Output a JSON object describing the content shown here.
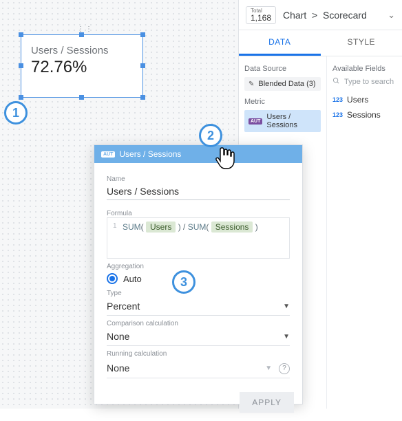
{
  "scorecard": {
    "label": "Users / Sessions",
    "value": "72.76%"
  },
  "panel": {
    "total_label": "Total",
    "total_value": "1,168",
    "breadcrumb_a": "Chart",
    "breadcrumb_sep": ">",
    "breadcrumb_b": "Scorecard",
    "tabs": {
      "data": "DATA",
      "style": "STYLE"
    },
    "config": {
      "data_source_lbl": "Data Source",
      "data_source_val": "Blended Data (3)",
      "metric_lbl": "Metric",
      "metric_badge": "AUT",
      "metric_val": "Users / Sessions"
    },
    "available": {
      "heading": "Available Fields",
      "search_placeholder": "Type to search",
      "fields": [
        {
          "badge": "123",
          "name": "Users"
        },
        {
          "badge": "123",
          "name": "Sessions"
        }
      ]
    }
  },
  "popup": {
    "head_badge": "AUT",
    "head_title": "Users / Sessions",
    "name_lbl": "Name",
    "name_val": "Users / Sessions",
    "formula_lbl": "Formula",
    "formula_line": "1",
    "formula_fn": "SUM",
    "formula_f1": "Users",
    "formula_div": "/",
    "formula_fn2": "SUM",
    "formula_f2": "Sessions",
    "agg_lbl": "Aggregation",
    "agg_val": "Auto",
    "type_lbl": "Type",
    "type_val": "Percent",
    "comp_lbl": "Comparison calculation",
    "comp_val": "None",
    "run_lbl": "Running calculation",
    "run_val": "None",
    "apply": "APPLY"
  },
  "steps": {
    "one": "1",
    "two": "2",
    "three": "3"
  }
}
